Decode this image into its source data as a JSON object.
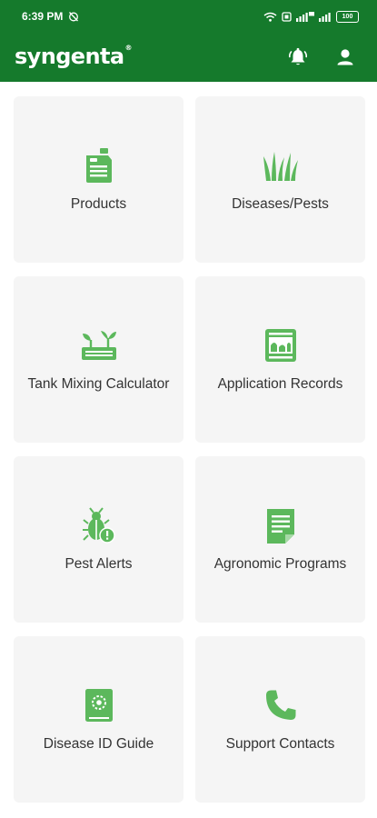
{
  "status_bar": {
    "time": "6:39 PM",
    "battery": "100"
  },
  "app_bar": {
    "brand": "syngenta",
    "trademark": "®"
  },
  "tiles": [
    {
      "label": "Products",
      "icon": "jerrycan-icon"
    },
    {
      "label": "Diseases/Pests",
      "icon": "grass-icon"
    },
    {
      "label": "Tank Mixing Calculator",
      "icon": "seedlings-tray-icon"
    },
    {
      "label": "Application Records",
      "icon": "field-record-icon"
    },
    {
      "label": "Pest Alerts",
      "icon": "bug-alert-icon"
    },
    {
      "label": "Agronomic Programs",
      "icon": "document-icon"
    },
    {
      "label": "Disease ID Guide",
      "icon": "guide-book-icon"
    },
    {
      "label": "Support Contacts",
      "icon": "phone-icon"
    }
  ],
  "colors": {
    "brand_green": "#157a2c",
    "icon_green": "#5cb85c",
    "tile_bg": "#f5f5f5"
  }
}
